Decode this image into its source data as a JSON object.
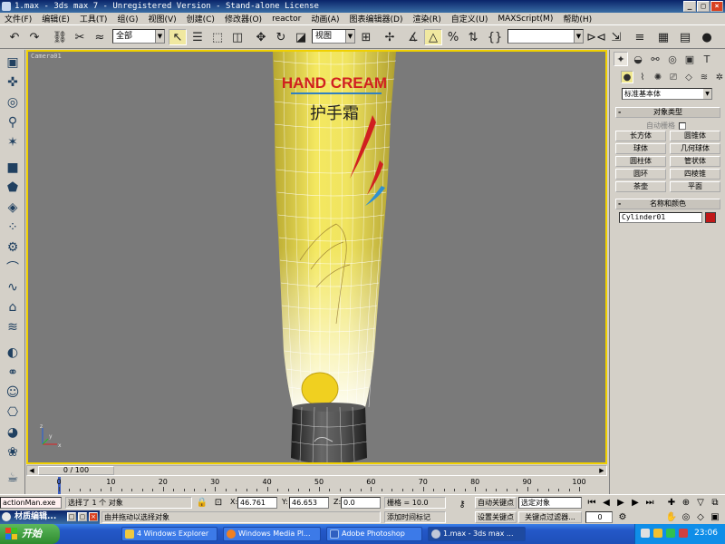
{
  "window": {
    "title": "1.max - 3ds max 7  - Unregistered Version - Stand-alone License"
  },
  "menu": [
    "文件(F)",
    "编辑(E)",
    "工具(T)",
    "组(G)",
    "视图(V)",
    "创建(C)",
    "修改器(O)",
    "reactor",
    "动画(A)",
    "图表编辑器(D)",
    "渲染(R)",
    "自定义(U)",
    "MAXScript(M)",
    "帮助(H)"
  ],
  "toolbar": {
    "selection_filter": "全部",
    "reference_coord": "视图",
    "named_selection": ""
  },
  "viewport": {
    "label": "Camera01",
    "product_text_en": "HAND CREAM",
    "product_text_cn": "护手霜",
    "axis_x": "x",
    "axis_y": "y",
    "axis_z": "z"
  },
  "command_panel": {
    "category_dropdown": "标准基本体",
    "object_type_header": "对象类型",
    "autogrid_label": "自动栅格",
    "primitives": [
      "长方体",
      "圆锥体",
      "球体",
      "几何球体",
      "圆柱体",
      "管状体",
      "圆环",
      "四棱锥",
      "茶壶",
      "平面"
    ],
    "name_color_header": "名称和颜色",
    "object_name": "Cylinder01",
    "object_color": "#c01818"
  },
  "timeline": {
    "slider_label": "0 / 100",
    "ruler_labels": [
      "0",
      "10",
      "20",
      "30",
      "40",
      "50",
      "60",
      "70",
      "80",
      "90",
      "100"
    ]
  },
  "status": {
    "script_listener": "actionMan.exe",
    "selection_status": "选择了 1 个 对象",
    "prompt": "由并拖动以选择对象",
    "x_label": "X:",
    "x_value": "46.761",
    "y_label": "Y:",
    "y_value": "46.653",
    "z_label": "Z:",
    "z_value": "0.0",
    "grid": "栅格 = 10.0",
    "add_time_tag": "添加时间标记",
    "auto_key": "自动关键点",
    "set_key": "设置关键点",
    "key_mode_dropdown": "选定对象",
    "key_filters": "关键点过滤器...",
    "frame_value": "0"
  },
  "material_editor": {
    "title": "材质编辑..."
  },
  "taskbar": {
    "start": "开始",
    "tasks": [
      "4 Windows Explorer",
      "Windows Media Pl...",
      "Adobe Photoshop",
      "1.max - 3ds max ..."
    ],
    "clock": "23:06"
  }
}
